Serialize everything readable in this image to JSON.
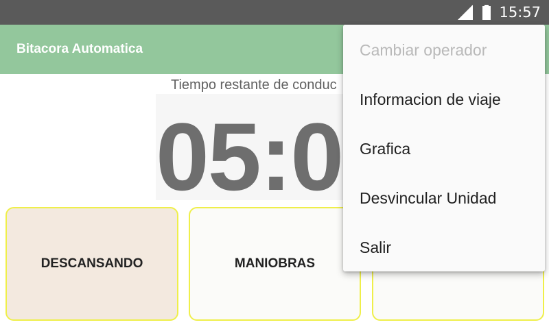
{
  "status_bar": {
    "time": "15:57",
    "signal_icon": "signal-icon",
    "battery_icon": "battery-icon"
  },
  "app_bar": {
    "title": "Bitacora Automatica"
  },
  "timer": {
    "label": "Tiempo restante de conduc",
    "value": "05:0"
  },
  "status_cards": [
    "DESCANSANDO",
    "MANIOBRAS",
    ""
  ],
  "menu": {
    "items": [
      {
        "label": "Cambiar operador",
        "enabled": false
      },
      {
        "label": "Informacion de viaje",
        "enabled": true
      },
      {
        "label": "Grafica",
        "enabled": true
      },
      {
        "label": "Desvincular Unidad",
        "enabled": true
      },
      {
        "label": "Salir",
        "enabled": true
      }
    ]
  },
  "colors": {
    "status_bar": "#5a5a5a",
    "app_bar": "#93c79c",
    "card_border": "#efef4a",
    "card_active": "#f3e9df",
    "timer_text": "#6e6e6e"
  }
}
